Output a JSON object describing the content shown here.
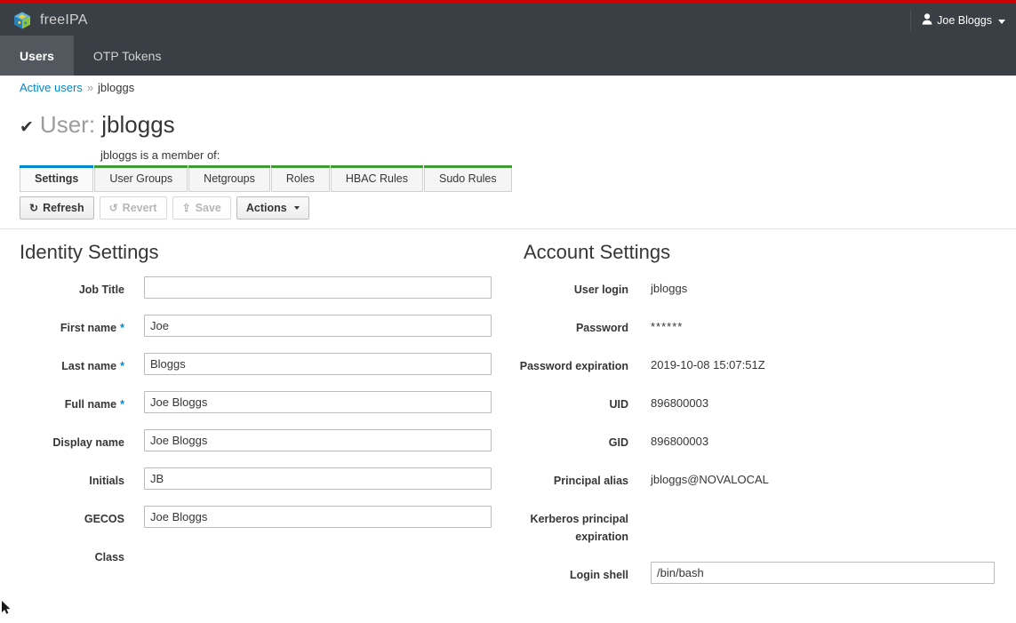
{
  "masthead": {
    "brand": "freeIPA",
    "logo_icon": "cube-icon",
    "user_icon": "user-icon",
    "user_name": "Joe Bloggs",
    "caret_icon": "chevron-down-icon",
    "accent_color": "#cc0000",
    "background_color": "#393f44"
  },
  "nav": {
    "tabs": [
      {
        "label": "Users",
        "active": true
      },
      {
        "label": "OTP Tokens",
        "active": false
      }
    ]
  },
  "breadcrumb": {
    "root": "Active users",
    "separator": "»",
    "current": "jbloggs"
  },
  "page": {
    "check_icon": "check-icon",
    "title_prefix": "User:",
    "title_value": "jbloggs",
    "member_label": "jbloggs is a member of:"
  },
  "facet_tabs": [
    {
      "label": "Settings",
      "kind": "settings",
      "accent": "#0088ce",
      "active": true
    },
    {
      "label": "User Groups",
      "kind": "member",
      "accent": "#3f9c35",
      "active": false
    },
    {
      "label": "Netgroups",
      "kind": "member",
      "accent": "#3f9c35",
      "active": false
    },
    {
      "label": "Roles",
      "kind": "member",
      "accent": "#3f9c35",
      "active": false
    },
    {
      "label": "HBAC Rules",
      "kind": "member",
      "accent": "#3f9c35",
      "active": false
    },
    {
      "label": "Sudo Rules",
      "kind": "member",
      "accent": "#3f9c35",
      "active": false
    }
  ],
  "toolbar": {
    "refresh_label": "Refresh",
    "refresh_icon": "refresh-icon",
    "revert_label": "Revert",
    "revert_icon": "undo-icon",
    "save_label": "Save",
    "save_icon": "upload-icon",
    "actions_label": "Actions",
    "actions_caret": "chevron-down-icon"
  },
  "identity": {
    "title": "Identity Settings",
    "fields": [
      {
        "label": "Job Title",
        "value": "",
        "required": false,
        "type": "input"
      },
      {
        "label": "First name",
        "value": "Joe",
        "required": true,
        "type": "input"
      },
      {
        "label": "Last name",
        "value": "Bloggs",
        "required": true,
        "type": "input"
      },
      {
        "label": "Full name",
        "value": "Joe Bloggs",
        "required": true,
        "type": "input"
      },
      {
        "label": "Display name",
        "value": "Joe Bloggs",
        "required": false,
        "type": "input"
      },
      {
        "label": "Initials",
        "value": "JB",
        "required": false,
        "type": "input"
      },
      {
        "label": "GECOS",
        "value": "Joe Bloggs",
        "required": false,
        "type": "input"
      },
      {
        "label": "Class",
        "value": "",
        "required": false,
        "type": "empty"
      }
    ]
  },
  "account": {
    "title": "Account Settings",
    "fields": [
      {
        "label": "User login",
        "value": "jbloggs",
        "type": "static"
      },
      {
        "label": "Password",
        "value": "******",
        "type": "password"
      },
      {
        "label": "Password expiration",
        "value": "2019-10-08 15:07:51Z",
        "type": "static"
      },
      {
        "label": "UID",
        "value": "896800003",
        "type": "static"
      },
      {
        "label": "GID",
        "value": "896800003",
        "type": "static"
      },
      {
        "label": "Principal alias",
        "value": "jbloggs@NOVALOCAL",
        "type": "static"
      },
      {
        "label": "Kerberos principal expiration",
        "value": "",
        "type": "empty"
      },
      {
        "label": "Login shell",
        "value": "/bin/bash",
        "type": "input"
      }
    ]
  }
}
